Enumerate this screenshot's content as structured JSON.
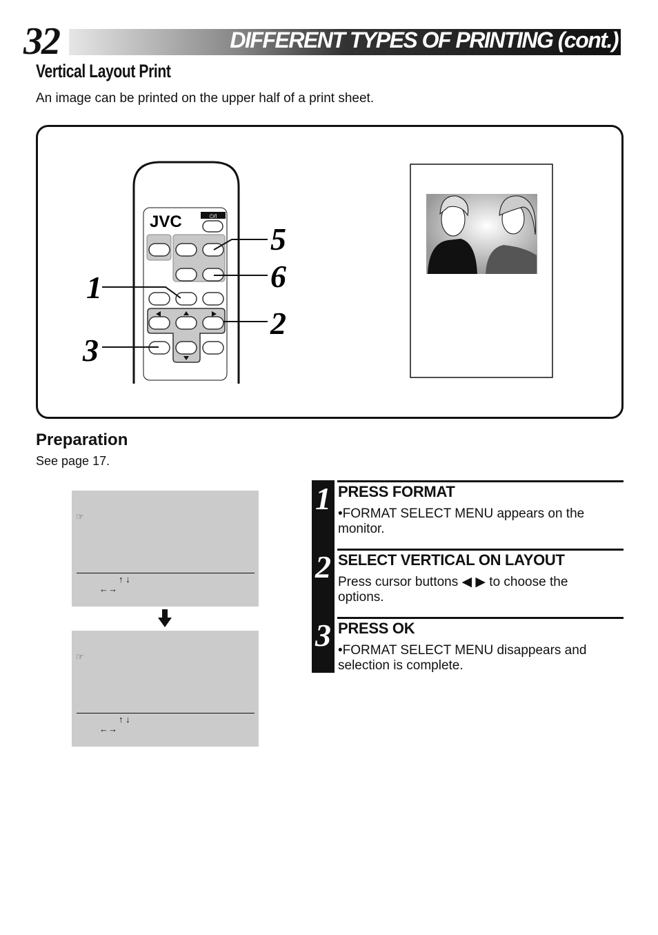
{
  "header": {
    "page_number": "32",
    "title": "DIFFERENT TYPES OF PRINTING (cont.)"
  },
  "section": {
    "title": "Vertical Layout Print",
    "intro": "An image can be printed on the upper half of a print sheet."
  },
  "illustration": {
    "brand": "JVC",
    "power_label": "⏻/I",
    "callouts": [
      "1",
      "2",
      "3",
      "5",
      "6"
    ]
  },
  "preparation": {
    "title": "Preparation",
    "text": "See  page 17."
  },
  "screens": [
    {
      "pointer": "☞",
      "updown": "↑ ↓",
      "leftright": "←→"
    },
    {
      "pointer": "☞",
      "updown": "↑ ↓",
      "leftright": "←→"
    }
  ],
  "steps": [
    {
      "num": "1",
      "title": "PRESS FORMAT",
      "body": "•FORMAT SELECT MENU appears on the monitor."
    },
    {
      "num": "2",
      "title": "SELECT VERTICAL ON LAYOUT",
      "body": "Press cursor buttons ◀  ▶ to choose the options."
    },
    {
      "num": "3",
      "title": "PRESS OK",
      "body": "•FORMAT SELECT MENU disappears and selection is complete."
    }
  ]
}
